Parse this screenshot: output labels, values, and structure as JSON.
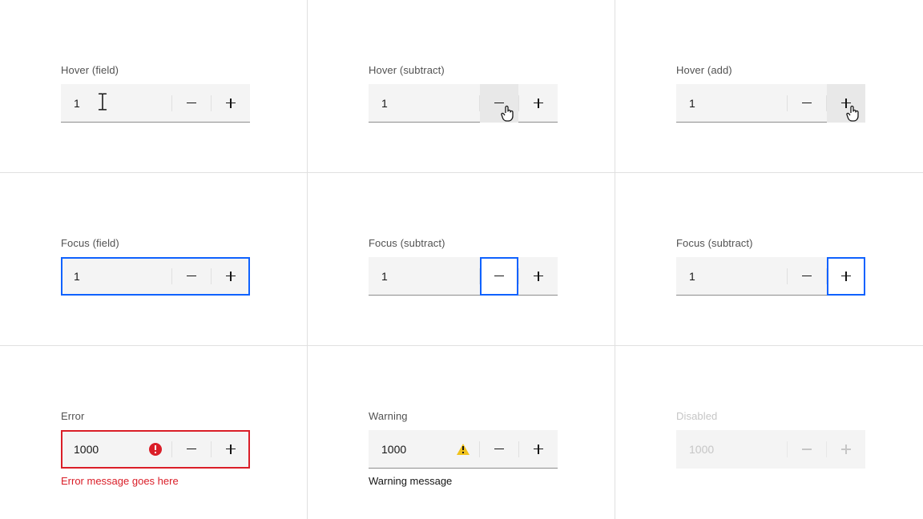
{
  "states": {
    "hover_field": {
      "label": "Hover (field)",
      "value": "1"
    },
    "hover_subtract": {
      "label": "Hover (subtract)",
      "value": "1"
    },
    "hover_add": {
      "label": "Hover (add)",
      "value": "1"
    },
    "focus_field": {
      "label": "Focus (field)",
      "value": "1"
    },
    "focus_subtract": {
      "label": "Focus (subtract)",
      "value": "1"
    },
    "focus_add": {
      "label": "Focus (subtract)",
      "value": "1"
    },
    "error": {
      "label": "Error",
      "value": "1000",
      "message": "Error message goes here"
    },
    "warning": {
      "label": "Warning",
      "value": "1000",
      "message": "Warning message"
    },
    "disabled": {
      "label": "Disabled",
      "value": "1000"
    }
  },
  "colors": {
    "focus": "#0f62fe",
    "error": "#da1e28",
    "warning": "#f1c21b",
    "field_bg": "#f4f4f4",
    "border": "#8d8d8d"
  }
}
